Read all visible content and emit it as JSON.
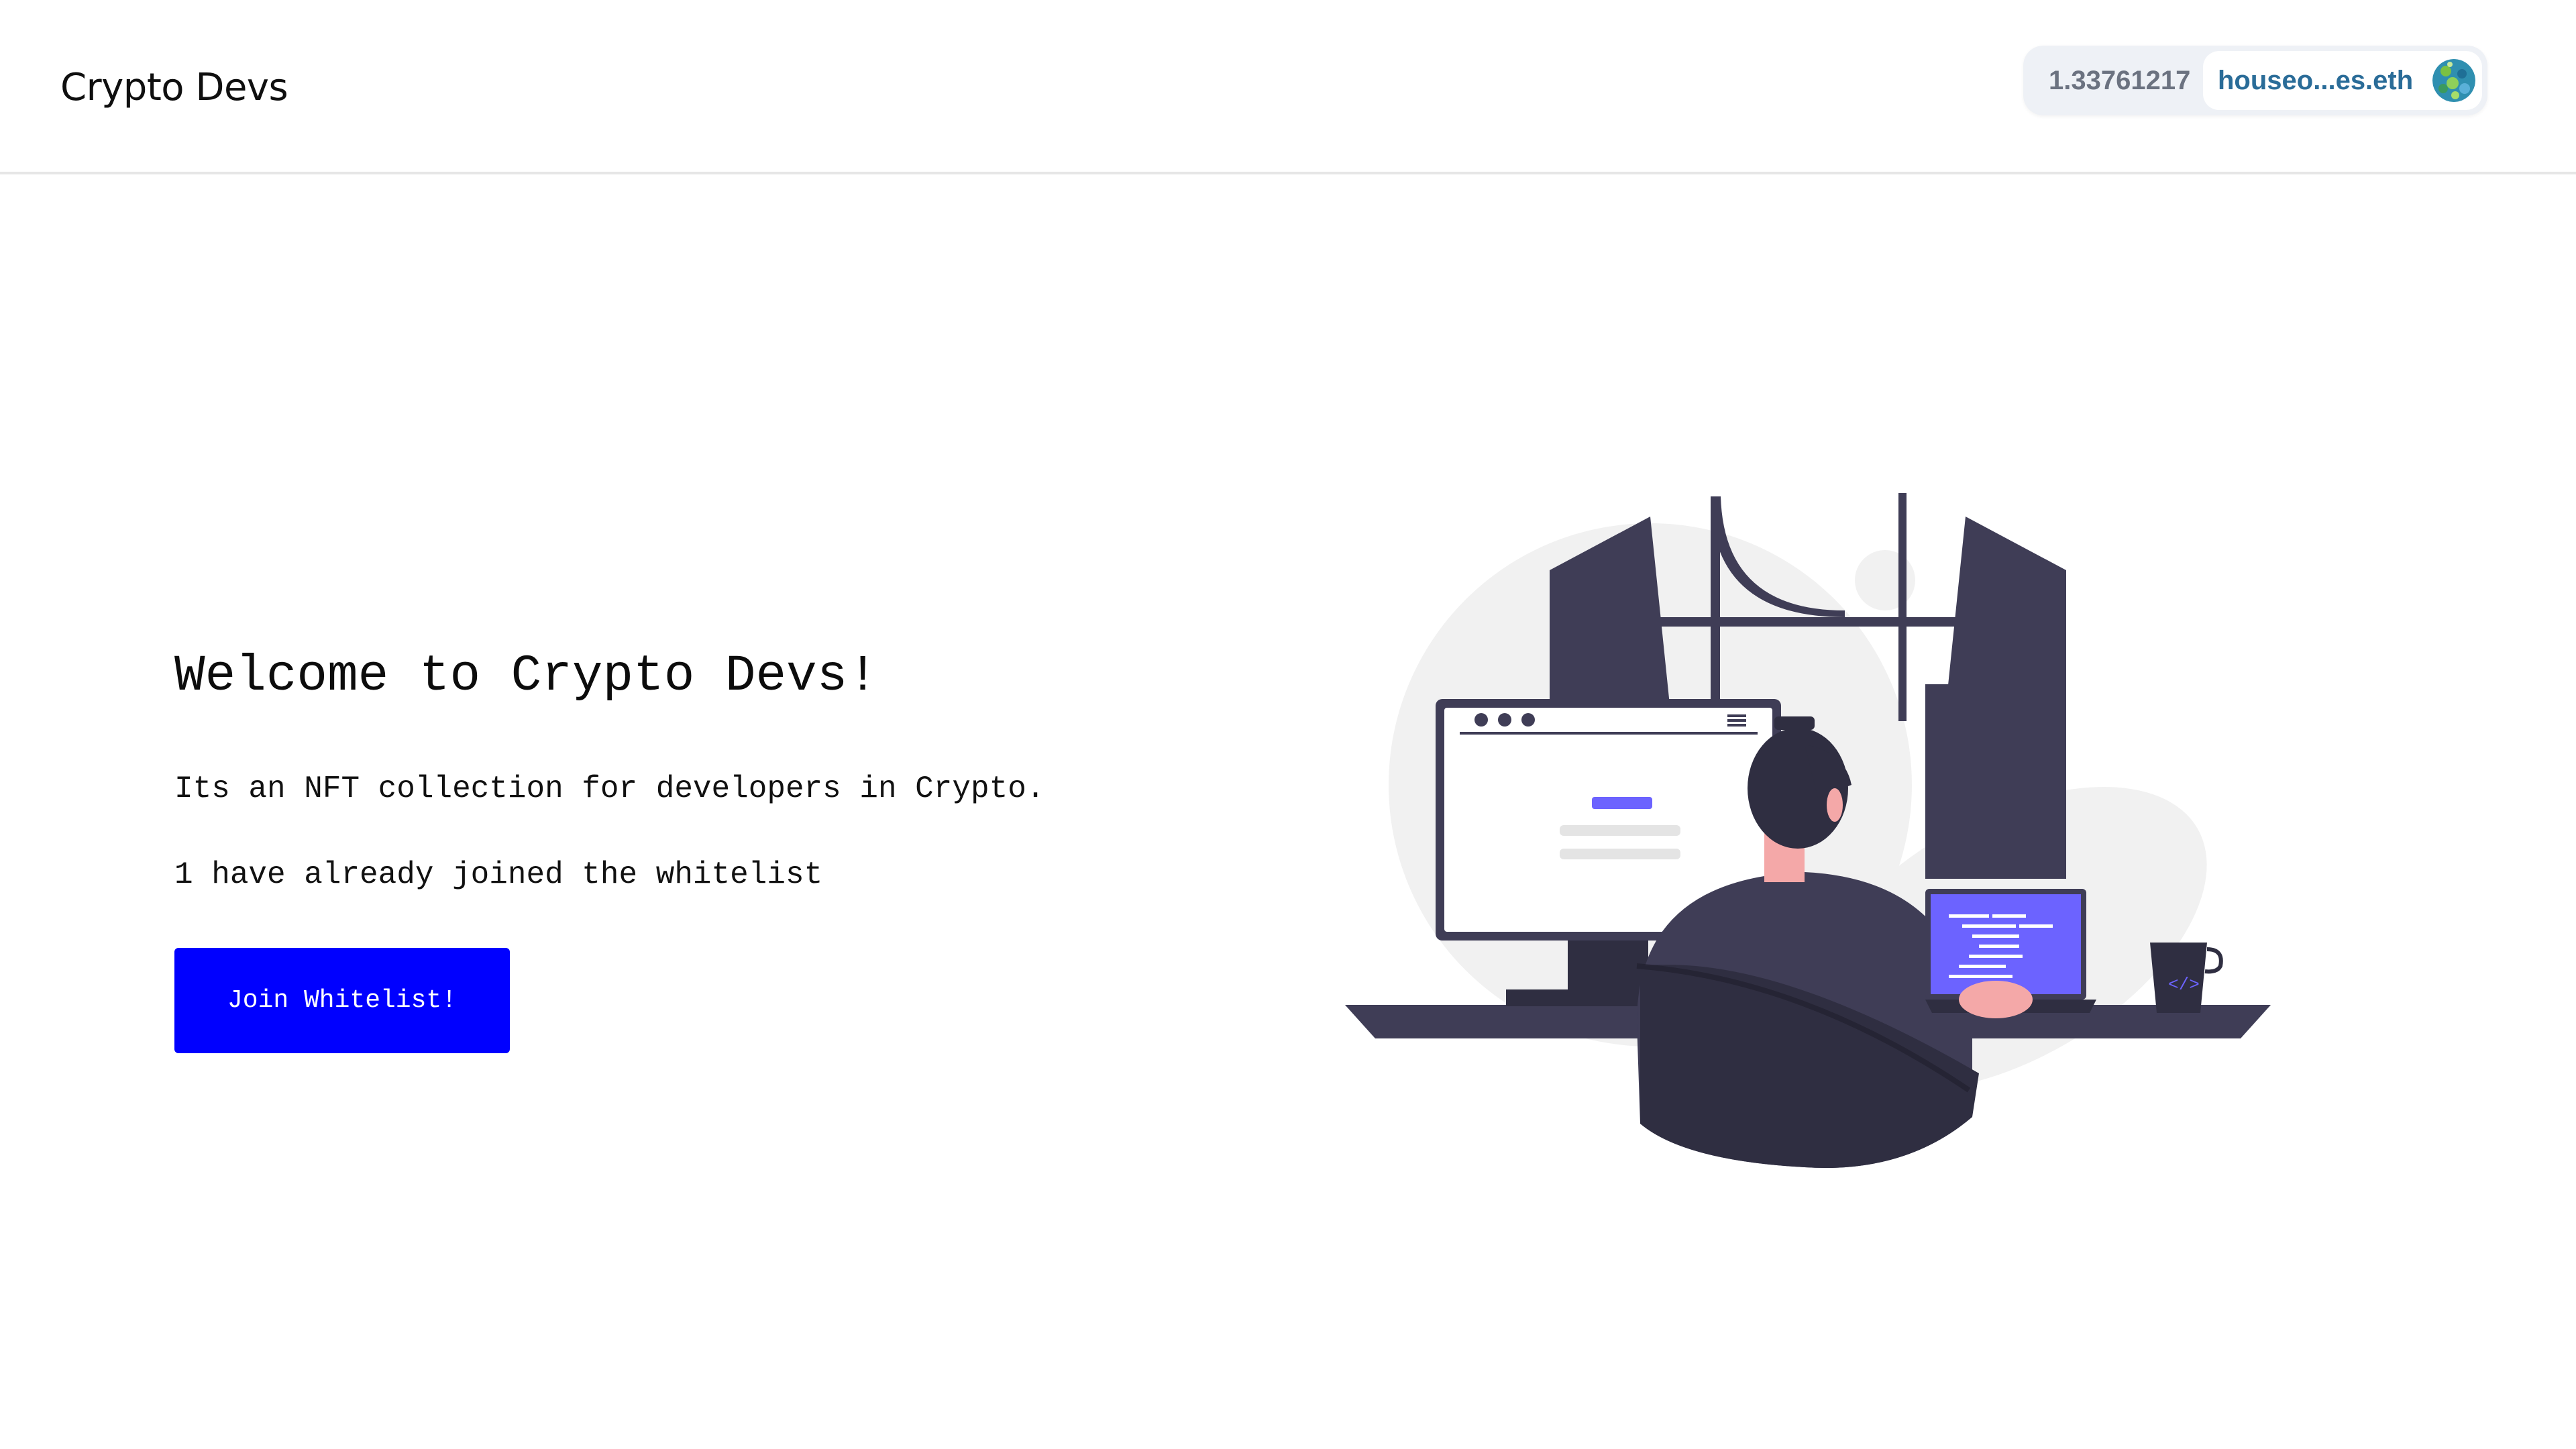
{
  "header": {
    "brand": "Crypto Devs",
    "wallet": {
      "balance": "1.33761217",
      "account": "houseo...es.eth",
      "avatar_icon": "ens-avatar-icon"
    }
  },
  "main": {
    "title": "Welcome to Crypto Devs!",
    "description": "Its an NFT collection for developers in Crypto.",
    "joined_count": "1",
    "joined_suffix": "have already joined the whitelist",
    "join_button": "Join Whitelist!"
  },
  "colors": {
    "button": "#0000ff",
    "illustration_accent": "#6c63ff",
    "illustration_dark": "#3f3d56",
    "account_text": "#2a6c98"
  }
}
